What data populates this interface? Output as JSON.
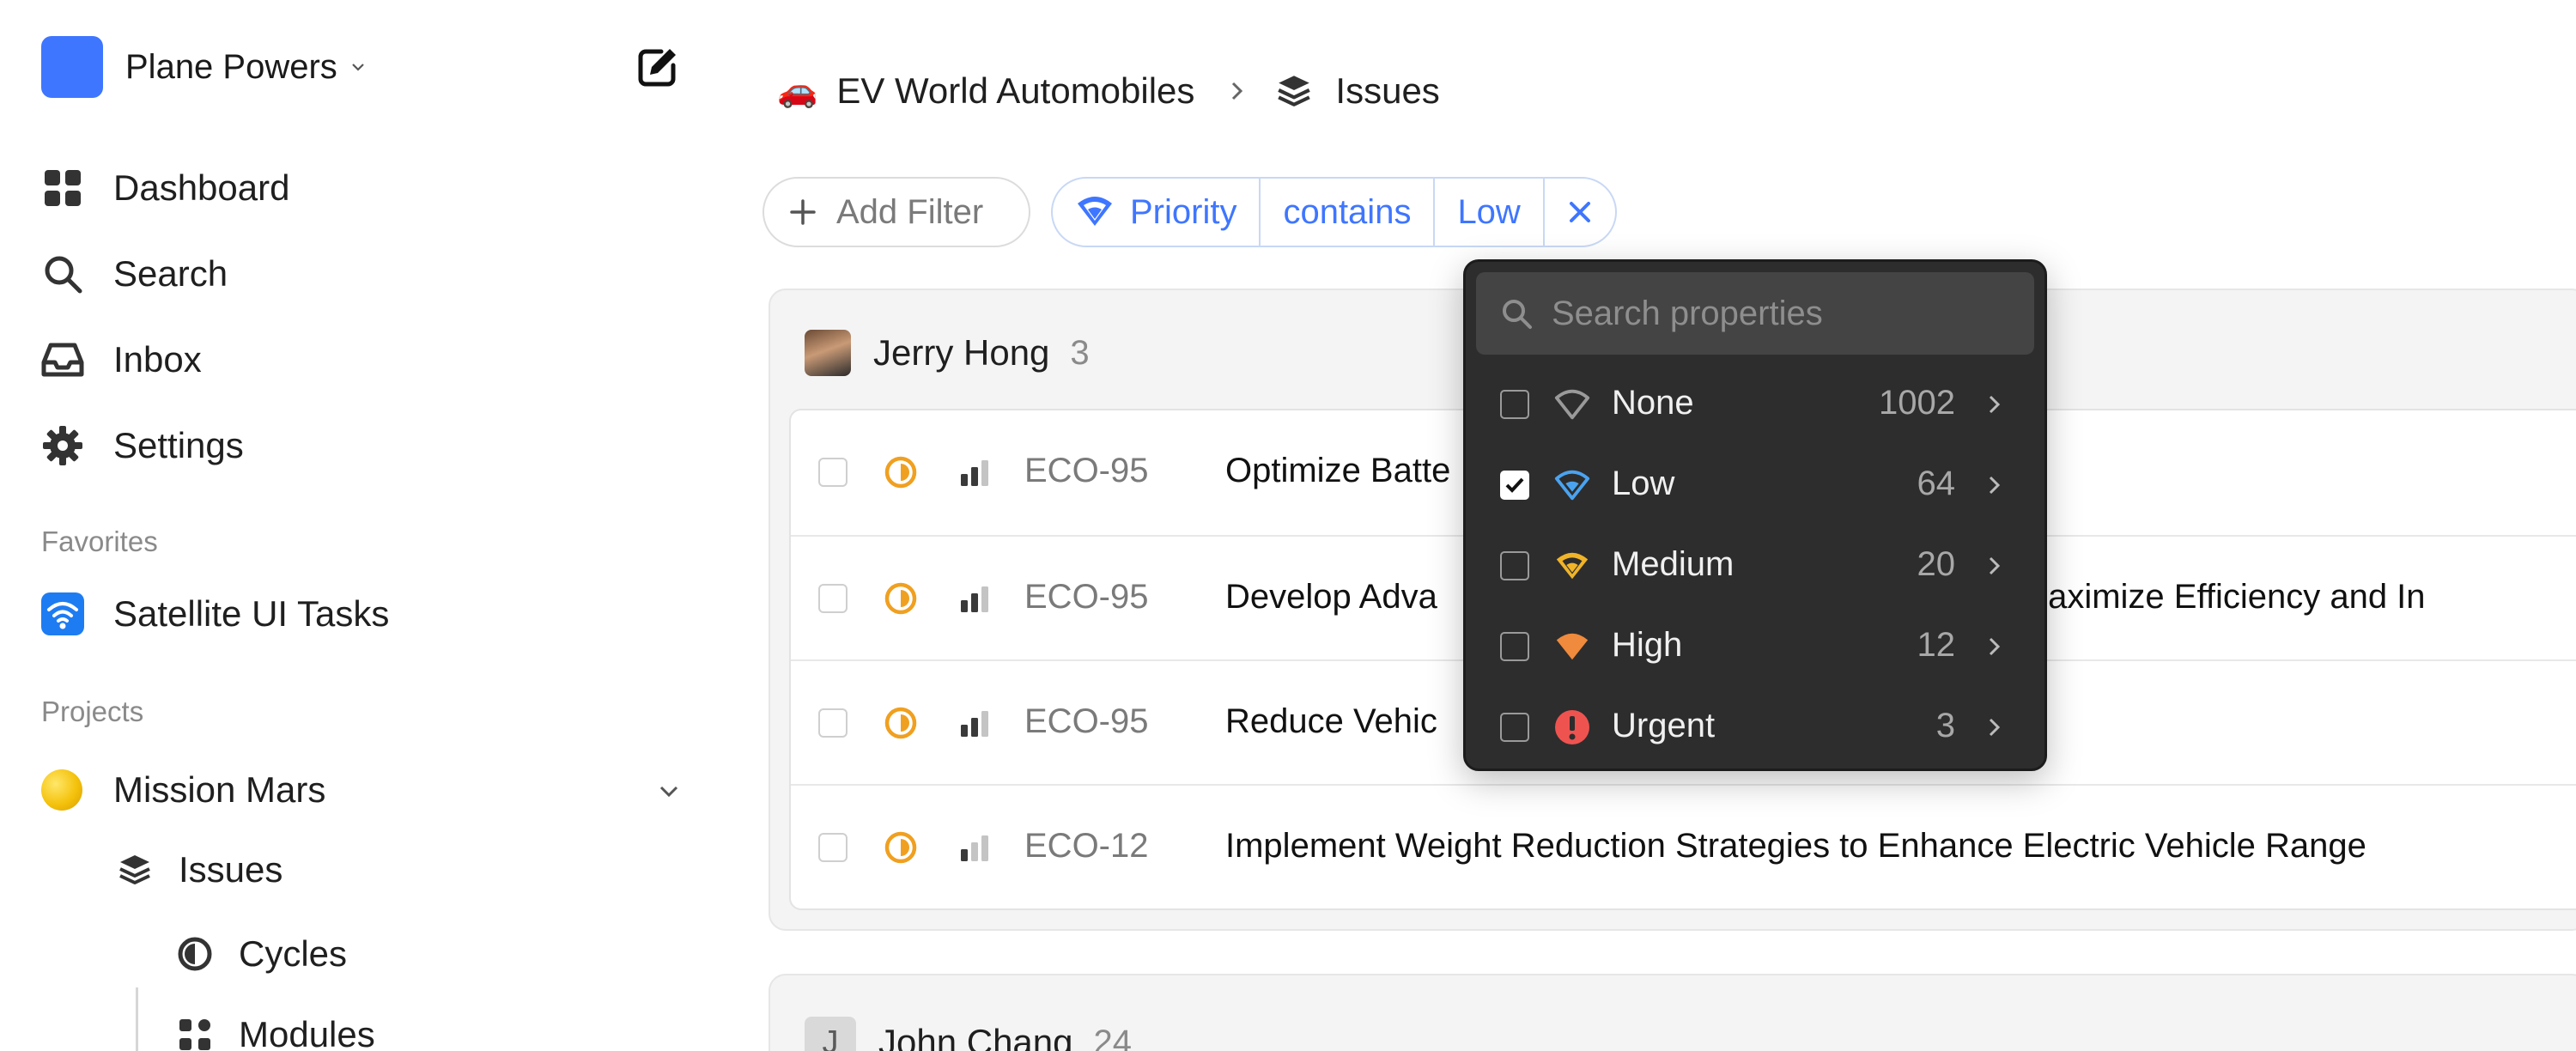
{
  "sidebar": {
    "workspace": {
      "name": "Plane Powers",
      "logo_color": "#3f76ff"
    },
    "nav": [
      {
        "label": "Dashboard",
        "icon": "grid-icon"
      },
      {
        "label": "Search",
        "icon": "search-icon"
      },
      {
        "label": "Inbox",
        "icon": "inbox-icon"
      },
      {
        "label": "Settings",
        "icon": "gear-icon"
      }
    ],
    "favorites_title": "Favorites",
    "favorites": [
      {
        "label": "Satellite UI Tasks",
        "icon": "wifi-icon"
      }
    ],
    "projects_title": "Projects",
    "project": {
      "label": "Mission Mars",
      "children": [
        {
          "label": "Issues",
          "icon": "layers-icon"
        },
        {
          "label": "Cycles",
          "icon": "cycle-icon"
        },
        {
          "label": "Modules",
          "icon": "modules-icon"
        }
      ]
    }
  },
  "breadcrumb": {
    "project": "EV World Automobiles",
    "project_emoji": "🚗",
    "page": "Issues"
  },
  "filters": {
    "add_label": "Add Filter",
    "active": {
      "property": "Priority",
      "operator": "contains",
      "value": "Low"
    }
  },
  "groups": [
    {
      "name": "Jerry Hong",
      "count": "3",
      "issues": [
        {
          "key": "ECO-95",
          "title": "Optimize Batte"
        },
        {
          "key": "ECO-95",
          "title": "Develop Adva                                                     m to Maximize Efficiency and In"
        },
        {
          "key": "ECO-95",
          "title": "Reduce Vehic"
        },
        {
          "key": "ECO-12",
          "title": "Implement Weight Reduction Strategies to Enhance Electric Vehicle Range"
        }
      ]
    },
    {
      "name": "John Chang",
      "count": "24",
      "avatar_letter": "J"
    }
  ],
  "dropdown": {
    "search_placeholder": "Search properties",
    "options": [
      {
        "label": "None",
        "count": "1002",
        "checked": false,
        "color": "#9a9a9a"
      },
      {
        "label": "Low",
        "count": "64",
        "checked": true,
        "color": "#4aa3f0"
      },
      {
        "label": "Medium",
        "count": "20",
        "checked": false,
        "color": "#f0b429"
      },
      {
        "label": "High",
        "count": "12",
        "checked": false,
        "color": "#f08a3c"
      },
      {
        "label": "Urgent",
        "count": "3",
        "checked": false,
        "color": "#ef5350"
      }
    ]
  },
  "colors": {
    "accent": "#3f76ff",
    "state_in_progress": "#f0a020"
  }
}
